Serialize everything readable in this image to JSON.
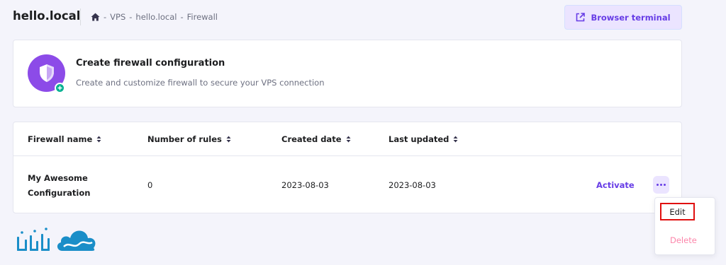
{
  "header": {
    "site_title": "hello.local",
    "breadcrumb": [
      "VPS",
      "hello.local",
      "Firewall"
    ],
    "breadcrumb_separator": "-",
    "terminal_button_label": "Browser terminal",
    "terminal_icon": "external-link-icon",
    "home_icon": "home-icon"
  },
  "create_card": {
    "icon": "shield-icon",
    "badge_icon": "plus-icon",
    "title": "Create firewall configuration",
    "description": "Create and customize firewall to secure your VPS connection"
  },
  "table": {
    "columns": [
      "Firewall name",
      "Number of rules",
      "Created date",
      "Last updated"
    ],
    "sort_icon": "sort-icon",
    "rows": [
      {
        "name_line1": "My Awesome",
        "name_line2": "Configuration",
        "rules": "0",
        "created": "2023-08-03",
        "updated": "2023-08-03",
        "action": "Activate"
      }
    ]
  },
  "menu": {
    "items": [
      "Edit",
      "Delete"
    ]
  },
  "colors": {
    "accent": "#673de6",
    "shield_bg": "#8c4be8",
    "badge": "#00b090",
    "danger": "#fc5185",
    "highlight": "#e01010",
    "logo": "#1a8ec8"
  },
  "logo": {
    "icon": "cloud-logo-icon"
  }
}
